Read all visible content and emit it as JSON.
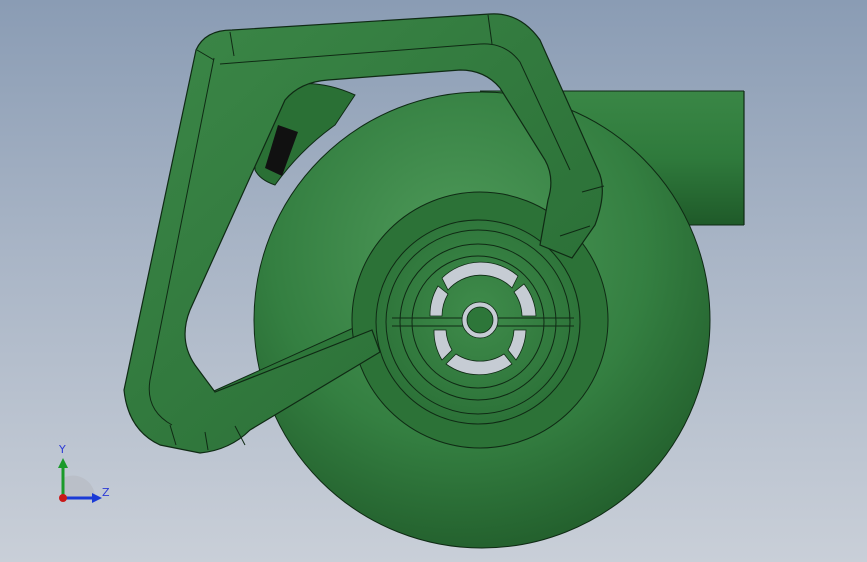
{
  "viewport": {
    "background_top": "#8a9cb4",
    "background_bottom": "#c9cfd8"
  },
  "model": {
    "body_color": "#2f7a3c",
    "body_highlight": "#4f9a5a",
    "body_shadow": "#1b4d24",
    "edge_color": "#0f2a14",
    "trigger_color": "#111111",
    "vent_color": "#c6ccd4"
  },
  "triad": {
    "y_label": "Y",
    "z_label": "Z",
    "y_axis_color": "#1a9a2a",
    "z_axis_color": "#1a3ad6",
    "origin_color": "#c81818"
  }
}
